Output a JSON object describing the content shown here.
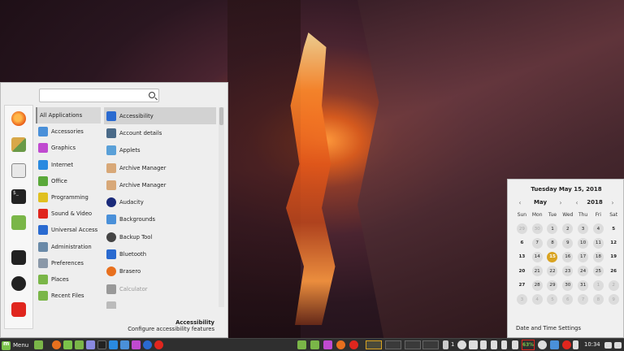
{
  "search": {
    "value": "",
    "placeholder": ""
  },
  "favorites": [
    {
      "name": "firefox-icon"
    },
    {
      "name": "software-manager-icon"
    },
    {
      "name": "settings-icon"
    },
    {
      "name": "terminal-icon"
    },
    {
      "name": "files-icon"
    },
    {
      "name": "lock-icon"
    },
    {
      "name": "logout-icon"
    },
    {
      "name": "power-icon"
    }
  ],
  "categories": [
    {
      "label": "All Applications",
      "color": "",
      "icon": "none"
    },
    {
      "label": "Accessories",
      "color": "#4a90d9",
      "icon": "accessories-icon"
    },
    {
      "label": "Graphics",
      "color": "#c04ad0",
      "icon": "graphics-icon"
    },
    {
      "label": "Internet",
      "color": "#2a8ae0",
      "icon": "internet-icon"
    },
    {
      "label": "Office",
      "color": "#5aa83a",
      "icon": "office-icon"
    },
    {
      "label": "Programming",
      "color": "#e0c020",
      "icon": "programming-icon"
    },
    {
      "label": "Sound & Video",
      "color": "#e0261e",
      "icon": "sound-video-icon"
    },
    {
      "label": "Universal Access",
      "color": "#2a6ad0",
      "icon": "universal-access-icon"
    },
    {
      "label": "Administration",
      "color": "#6a8aa8",
      "icon": "administration-icon"
    },
    {
      "label": "Preferences",
      "color": "#8a98a8",
      "icon": "preferences-icon"
    },
    {
      "label": "Places",
      "color": "#7ab648",
      "icon": "places-icon"
    },
    {
      "label": "Recent Files",
      "color": "#7ab648",
      "icon": "recent-files-icon"
    }
  ],
  "apps": [
    {
      "label": "Accessibility",
      "color": "#2a6ad0",
      "icon": "accessibility-icon"
    },
    {
      "label": "Account details",
      "color": "#4a6a88",
      "icon": "account-details-icon"
    },
    {
      "label": "Applets",
      "color": "#5aa0d8",
      "icon": "applets-icon"
    },
    {
      "label": "Archive Manager",
      "color": "#d8a878",
      "icon": "archive-manager-icon"
    },
    {
      "label": "Archive Manager",
      "color": "#d8a878",
      "icon": "archive-manager-icon"
    },
    {
      "label": "Audacity",
      "color": "#1a2a7a",
      "icon": "audacity-icon"
    },
    {
      "label": "Backgrounds",
      "color": "#4a90d9",
      "icon": "backgrounds-icon"
    },
    {
      "label": "Backup Tool",
      "color": "#444444",
      "icon": "backup-tool-icon"
    },
    {
      "label": "Bluetooth",
      "color": "#2a6ad0",
      "icon": "bluetooth-icon"
    },
    {
      "label": "Brasero",
      "color": "#e8701e",
      "icon": "brasero-icon"
    },
    {
      "label": "Calculator",
      "color": "#999999",
      "icon": "calculator-icon"
    },
    {
      "label": "",
      "color": "#bbbbbb",
      "icon": "app-icon"
    }
  ],
  "description": {
    "title": "Accessibility",
    "subtitle": "Configure accessibility features"
  },
  "calendar": {
    "date_title": "Tuesday May 15, 2018",
    "month": "May",
    "year": "2018",
    "prev_arrow": "‹",
    "next_arrow": "›",
    "weekdays": [
      "Sun",
      "Mon",
      "Tue",
      "Wed",
      "Thu",
      "Fri",
      "Sat"
    ],
    "weeks": [
      [
        {
          "d": "29",
          "s": "out"
        },
        {
          "d": "30",
          "s": "out"
        },
        {
          "d": "1",
          "s": ""
        },
        {
          "d": "2",
          "s": ""
        },
        {
          "d": "3",
          "s": ""
        },
        {
          "d": "4",
          "s": ""
        },
        {
          "d": "5",
          "s": "bold"
        }
      ],
      [
        {
          "d": "6",
          "s": "bold"
        },
        {
          "d": "7",
          "s": ""
        },
        {
          "d": "8",
          "s": ""
        },
        {
          "d": "9",
          "s": ""
        },
        {
          "d": "10",
          "s": ""
        },
        {
          "d": "11",
          "s": ""
        },
        {
          "d": "12",
          "s": "bold"
        }
      ],
      [
        {
          "d": "13",
          "s": "bold"
        },
        {
          "d": "14",
          "s": ""
        },
        {
          "d": "15",
          "s": "today"
        },
        {
          "d": "16",
          "s": ""
        },
        {
          "d": "17",
          "s": ""
        },
        {
          "d": "18",
          "s": ""
        },
        {
          "d": "19",
          "s": "bold"
        }
      ],
      [
        {
          "d": "20",
          "s": "bold"
        },
        {
          "d": "21",
          "s": ""
        },
        {
          "d": "22",
          "s": ""
        },
        {
          "d": "23",
          "s": ""
        },
        {
          "d": "24",
          "s": ""
        },
        {
          "d": "25",
          "s": ""
        },
        {
          "d": "26",
          "s": "bold"
        }
      ],
      [
        {
          "d": "27",
          "s": "bold"
        },
        {
          "d": "28",
          "s": ""
        },
        {
          "d": "29",
          "s": ""
        },
        {
          "d": "30",
          "s": ""
        },
        {
          "d": "31",
          "s": ""
        },
        {
          "d": "1",
          "s": "out"
        },
        {
          "d": "2",
          "s": "out"
        }
      ],
      [
        {
          "d": "3",
          "s": "out"
        },
        {
          "d": "4",
          "s": "out"
        },
        {
          "d": "5",
          "s": "out"
        },
        {
          "d": "6",
          "s": "out"
        },
        {
          "d": "7",
          "s": "out"
        },
        {
          "d": "8",
          "s": "out"
        },
        {
          "d": "9",
          "s": "out"
        }
      ]
    ],
    "settings_label": "Date and Time Settings"
  },
  "taskbar": {
    "menu_label": "Menu",
    "workspace_count": "1",
    "battery": "63%",
    "clock": "10:34"
  },
  "colors": {
    "accent": "#d9a321",
    "menu_bg": "#eeeeee",
    "panel_bg": "#2f2f2f"
  }
}
